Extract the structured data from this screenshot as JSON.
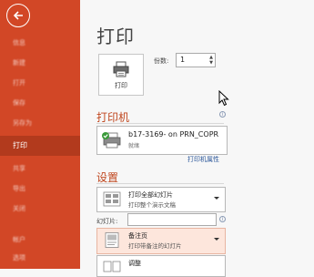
{
  "backstage": {
    "nav": [
      {
        "label": "信息",
        "active": false
      },
      {
        "label": "新建",
        "active": false
      },
      {
        "label": "打开",
        "active": false
      },
      {
        "label": "保存",
        "active": false
      },
      {
        "label": "另存为",
        "active": false
      },
      {
        "label": "打印",
        "active": true
      },
      {
        "label": "共享",
        "active": false
      },
      {
        "label": "导出",
        "active": false
      },
      {
        "label": "关闭",
        "active": false
      },
      {
        "label": "帐户",
        "active": false
      },
      {
        "label": "选项",
        "active": false
      }
    ],
    "accent_color": "#d24726"
  },
  "print": {
    "title": "打印",
    "print_button_label": "打印",
    "copies_label": "份数:",
    "copies_value": "1"
  },
  "printer": {
    "section_title": "打印机",
    "name": "b17-3169- on PRN_COPR",
    "status": "就绪",
    "properties_link": "打印机属性"
  },
  "settings": {
    "section_title": "设置",
    "range": {
      "title": "打印全部幻灯片",
      "subtitle": "打印整个演示文稿"
    },
    "slides_label": "幻灯片:",
    "slides_value": "",
    "layout": {
      "title": "备注页",
      "subtitle": "打印带备注的幻灯片"
    },
    "collate": {
      "title": "调整"
    }
  }
}
